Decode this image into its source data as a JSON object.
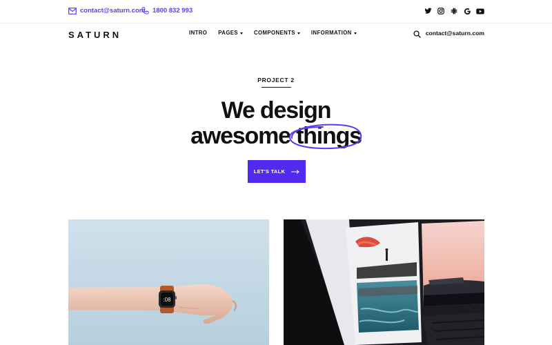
{
  "topbar": {
    "email": "contact@saturn.com",
    "phone": "1800 832 993",
    "socials": [
      "twitter-icon",
      "instagram-icon",
      "slack-icon",
      "google-icon",
      "youtube-icon"
    ]
  },
  "nav": {
    "logo": "SATURN",
    "items": [
      {
        "label": "INTRO",
        "dropdown": false
      },
      {
        "label": "PAGES",
        "dropdown": true
      },
      {
        "label": "COMPONENTS",
        "dropdown": true
      },
      {
        "label": "INFORMATION",
        "dropdown": true
      }
    ],
    "email": "contact@saturn.com"
  },
  "hero": {
    "eyebrow": "PROJECT 2",
    "line1": "We design",
    "line2_a": "awesome",
    "line2_b": "things",
    "cta": "LET'S TALK"
  },
  "colors": {
    "accent": "#5229ef",
    "link": "#5b3df0",
    "text": "#111111"
  },
  "cards": [
    {
      "name": "wrist-watch-photo"
    },
    {
      "name": "laptop-screen-photo"
    }
  ]
}
